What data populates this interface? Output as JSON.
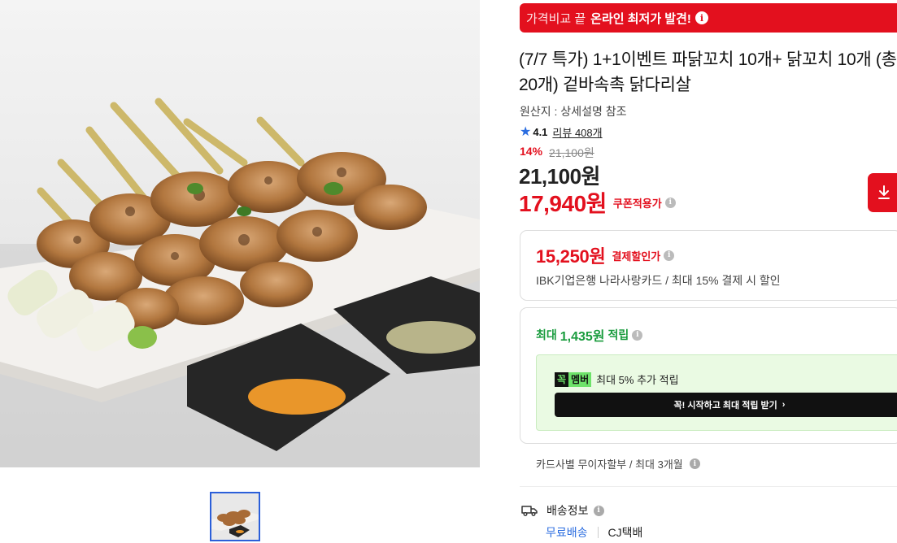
{
  "banner": {
    "light_text": "가격비교 끝",
    "strong_text": "온라인 최저가 발견!",
    "info_glyph": "i"
  },
  "product": {
    "title": "(7/7 특가) 1+1이벤트 파닭꼬치 10개+ 닭꼬치 10개 (총20개) 겉바속촉 닭다리살",
    "origin": "원산지 : 상세설명 참조",
    "rating": "4.1",
    "reviews": "리뷰 408개"
  },
  "price": {
    "discount_rate": "14%",
    "original": "21,100원",
    "sale": "21,100원",
    "coupon_price": "17,940원",
    "coupon_label": "쿠폰적용가"
  },
  "payment": {
    "price": "15,250원",
    "label": "결제할인가",
    "desc": "IBK기업은행 나라사랑카드 / 최대 15% 결제 시 할인"
  },
  "points": {
    "prefix": "최대",
    "amount": "1,435원",
    "suffix": "적립",
    "member_badge_1": "꼭",
    "member_badge_2": "멤버",
    "member_text": "최대 5% 추가 적립",
    "member_cta": "꼭! 시작하고 최대 적립 받기",
    "cta_chevron": "›"
  },
  "installment": "카드사별 무이자할부 / 최대 3개월",
  "delivery": {
    "heading": "배송정보",
    "free": "무료배송",
    "carrier": "CJ택배"
  },
  "colors": {
    "brand_red": "#e3101e",
    "link_blue": "#2b6de0",
    "points_green": "#1a9c3e"
  }
}
